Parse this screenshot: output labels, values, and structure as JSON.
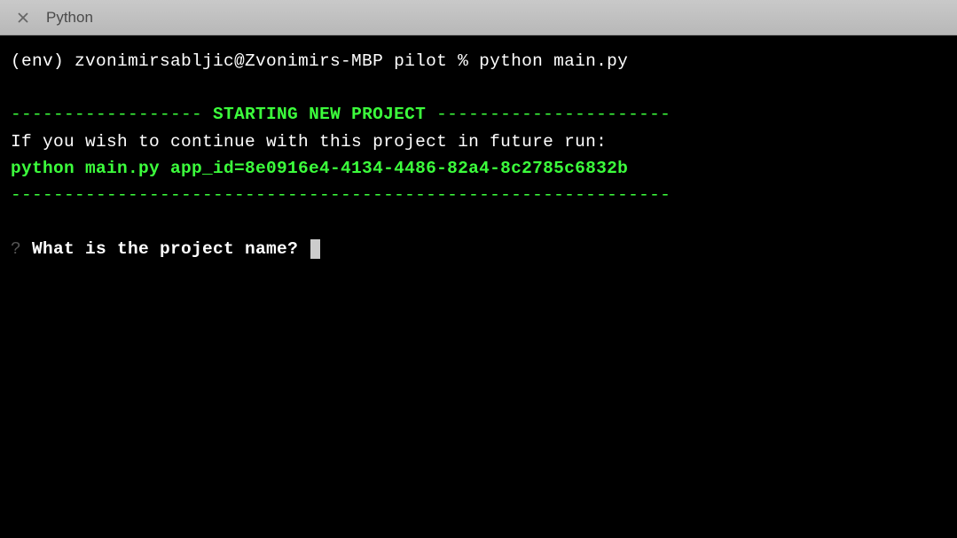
{
  "window": {
    "title": "Python"
  },
  "terminal": {
    "prompt": "(env) zvonimirsabljic@Zvonimirs-MBP pilot % python main.py",
    "header_dashes_left": "------------------ ",
    "header_title": "STARTING NEW PROJECT",
    "header_dashes_right": " ----------------------",
    "continue_msg": "If you wish to continue with this project in future run:",
    "continue_cmd": "python main.py app_id=8e0916e4-4134-4486-82a4-8c2785c6832b",
    "bottom_dashes": "--------------------------------------------------------------",
    "question_mark": "?",
    "question_text": " What is the project name? "
  }
}
